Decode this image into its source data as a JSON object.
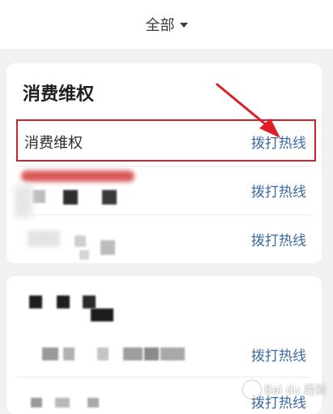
{
  "filter": {
    "label": "全部",
    "icon": "chevron-down-icon"
  },
  "sections": [
    {
      "title": "消费维权",
      "rows": [
        {
          "name": "消费维权",
          "action": "拨打热线",
          "highlighted": true
        },
        {
          "name": "",
          "action": "拨打热线"
        },
        {
          "name": "",
          "action": "拨打热线"
        }
      ]
    },
    {
      "title": "",
      "rows": [
        {
          "name": "",
          "action": "拨打热线"
        },
        {
          "name": "",
          "action": "拨打热线"
        }
      ]
    }
  ],
  "annotation": {
    "highlight_color": "#c8252b",
    "arrow_color": "#e01e26"
  },
  "watermark": {
    "text": "Bai du 经验"
  },
  "colors": {
    "link": "#3a6aa6",
    "background": "#f1f1f3"
  }
}
